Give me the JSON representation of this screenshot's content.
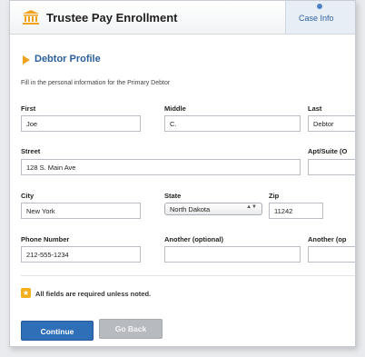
{
  "header": {
    "title": "Trustee Pay Enrollment",
    "logo_icon": "courthouse-icon",
    "case_info_label": "Case Info"
  },
  "section": {
    "title": "Debtor Profile",
    "instructions": "Fill in the personal information for the Primary Debtor"
  },
  "fields": {
    "first": {
      "label": "First",
      "value": "Joe"
    },
    "middle": {
      "label": "Middle",
      "value": "C."
    },
    "last": {
      "label": "Last",
      "value": "Debtor"
    },
    "street": {
      "label": "Street",
      "value": "128 S. Main Ave"
    },
    "apt": {
      "label": "Apt/Suite (O",
      "value": ""
    },
    "city": {
      "label": "City",
      "value": "New York"
    },
    "state": {
      "label": "State",
      "value": "North Dakota"
    },
    "zip": {
      "label": "Zip",
      "value": "11242"
    },
    "phone": {
      "label": "Phone Number",
      "value": "212-555-1234"
    },
    "another1": {
      "label": "Another (optional)",
      "value": ""
    },
    "another2": {
      "label": "Another (op",
      "value": ""
    }
  },
  "note": {
    "text": "All fields are required unless noted."
  },
  "buttons": {
    "continue": "Continue",
    "back": "Go Back"
  },
  "colors": {
    "accent": "#2f6fb7",
    "section_arrow": "#f1a21b",
    "title_blue": "#2b5e9c"
  }
}
